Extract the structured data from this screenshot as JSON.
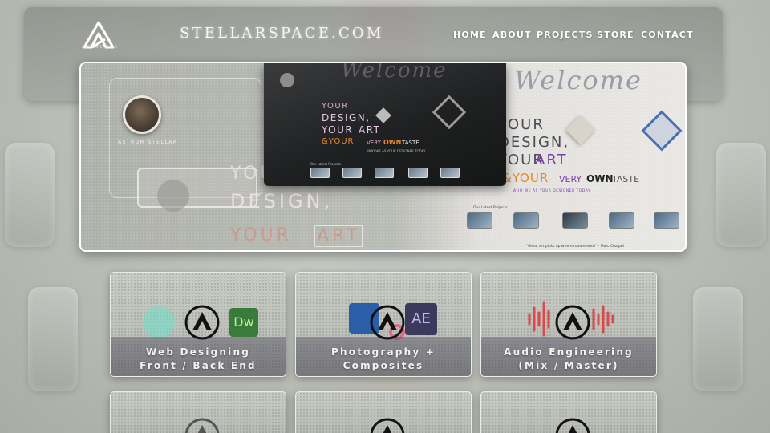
{
  "header": {
    "site_title": "STELLARSPACE.COM",
    "logo_caption": "ASTRUM STELLAR",
    "nav": [
      {
        "label": "HOME"
      },
      {
        "label": "ABOUT"
      },
      {
        "label": "PROJECTS"
      },
      {
        "label": "STORE"
      },
      {
        "label": "CONTACT"
      }
    ]
  },
  "hero": {
    "avatar_name": "ASTRUM STELLAR",
    "headline": [
      "YOUR",
      "DESIGN,",
      "YOUR",
      "ART",
      "&YOUR",
      "VERY",
      "OWN",
      "TASTE"
    ],
    "welcome": "Welcome",
    "subline": "WHO WE AS YOUR DESIGNER TODAY",
    "latest_label": "Our Latest Projects",
    "quote": "\"Great art picks up where nature ends\" - Marc Chagall",
    "accent_color": "#e9882a"
  },
  "services": [
    {
      "line1": "Web Designing",
      "line2": "Front / Back End",
      "icon": "software-icons"
    },
    {
      "line1": "Photography +",
      "line2": "Composites",
      "icon": "adobe-icons"
    },
    {
      "line1": "Audio Engineering",
      "line2": "(Mix / Master)",
      "icon": "audio-waveform-icon"
    }
  ]
}
